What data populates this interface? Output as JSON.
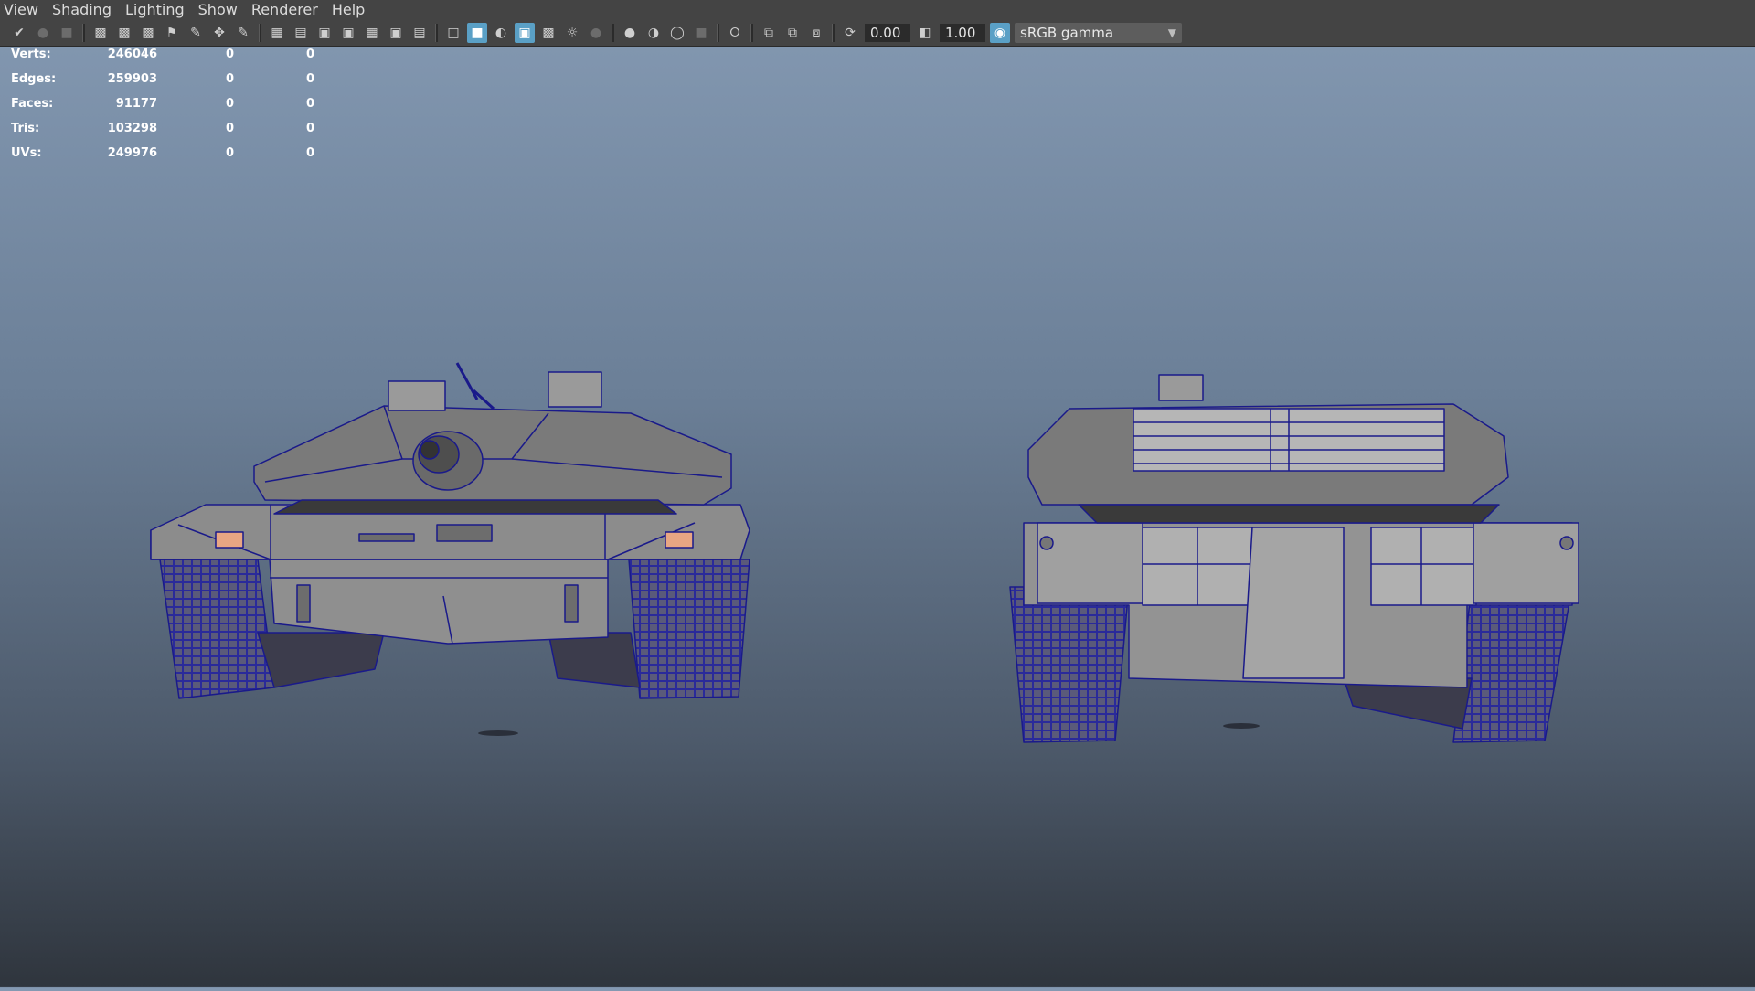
{
  "menu": [
    "View",
    "Shading",
    "Lighting",
    "Show",
    "Renderer",
    "Help"
  ],
  "toolbar": {
    "icons": [
      "select-camera-icon",
      "lock-camera-icon",
      "camera-attributes-icon",
      "camera-icon",
      "bookmark-icon",
      "image-plane-icon",
      "2d-pan-zoom-icon",
      "grease-pencil-icon",
      "grid-icon",
      "film-gate-icon",
      "resolution-gate-icon",
      "gate-mask-icon",
      "field-chart-icon",
      "safe-action-icon",
      "safe-title-icon",
      "wireframe-icon",
      "smooth-shade-icon",
      "default-lighting-icon",
      "wireframe-on-shaded-icon",
      "textured-icon",
      "use-all-lights-icon",
      "shadows-icon",
      "screen-space-ao-icon",
      "motion-blur-icon",
      "anti-aliasing-icon",
      "depth-of-field-icon",
      "isolate-select-icon",
      "xray-icon",
      "xray-joints-icon",
      "xray-components-icon",
      "exposure-icon",
      "gamma-icon",
      "color-management-icon"
    ],
    "exposure_value": "0.00",
    "gamma_value": "1.00",
    "colorspace": "sRGB gamma"
  },
  "hud": {
    "rows": [
      {
        "label": "Verts:",
        "value": "246046",
        "v2": "0",
        "v3": "0"
      },
      {
        "label": "Edges:",
        "value": "259903",
        "v2": "0",
        "v3": "0"
      },
      {
        "label": "Faces:",
        "value": "91177",
        "v2": "0",
        "v3": "0"
      },
      {
        "label": "Tris:",
        "value": "103298",
        "v2": "0",
        "v3": "0"
      },
      {
        "label": "UVs:",
        "value": "249976",
        "v2": "0",
        "v3": "0"
      }
    ]
  },
  "colors": {
    "wire": "#1a1a8a",
    "mesh": "#8a8a8a",
    "menubar": "#444444",
    "accent": "#5aa0c6"
  }
}
